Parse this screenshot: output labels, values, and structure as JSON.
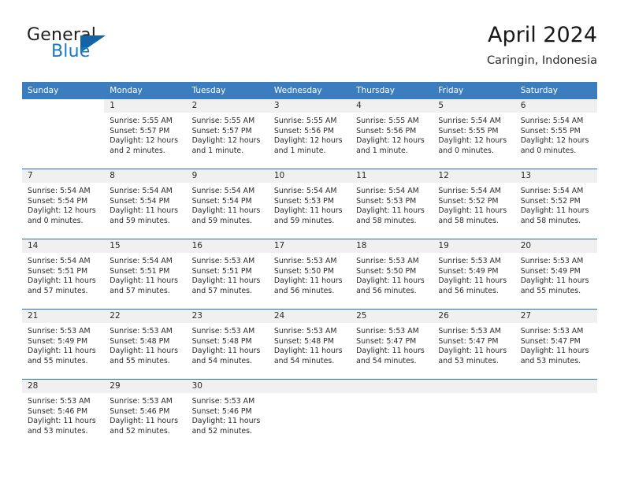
{
  "brand": {
    "word_general": "General",
    "word_blue": "Blue",
    "triangle_icon": "brand-triangle-icon",
    "accent_color": "#1b79c3"
  },
  "header": {
    "title": "April 2024",
    "subtitle": "Caringin, Indonesia"
  },
  "theme": {
    "header_blue": "#3b7dbf",
    "rule_blue": "#2a6cb0",
    "daynum_band": "#f0f0f0",
    "text": "#2b2b2b"
  },
  "calendar": {
    "weekday_headers": [
      "Sunday",
      "Monday",
      "Tuesday",
      "Wednesday",
      "Thursday",
      "Friday",
      "Saturday"
    ],
    "weeks": [
      [
        {
          "day": "",
          "blank": true,
          "lines": []
        },
        {
          "day": "1",
          "lines": [
            "Sunrise: 5:55 AM",
            "Sunset: 5:57 PM",
            "Daylight: 12 hours",
            "and 2 minutes."
          ]
        },
        {
          "day": "2",
          "lines": [
            "Sunrise: 5:55 AM",
            "Sunset: 5:57 PM",
            "Daylight: 12 hours",
            "and 1 minute."
          ]
        },
        {
          "day": "3",
          "lines": [
            "Sunrise: 5:55 AM",
            "Sunset: 5:56 PM",
            "Daylight: 12 hours",
            "and 1 minute."
          ]
        },
        {
          "day": "4",
          "lines": [
            "Sunrise: 5:55 AM",
            "Sunset: 5:56 PM",
            "Daylight: 12 hours",
            "and 1 minute."
          ]
        },
        {
          "day": "5",
          "lines": [
            "Sunrise: 5:54 AM",
            "Sunset: 5:55 PM",
            "Daylight: 12 hours",
            "and 0 minutes."
          ]
        },
        {
          "day": "6",
          "lines": [
            "Sunrise: 5:54 AM",
            "Sunset: 5:55 PM",
            "Daylight: 12 hours",
            "and 0 minutes."
          ]
        }
      ],
      [
        {
          "day": "7",
          "lines": [
            "Sunrise: 5:54 AM",
            "Sunset: 5:54 PM",
            "Daylight: 12 hours",
            "and 0 minutes."
          ]
        },
        {
          "day": "8",
          "lines": [
            "Sunrise: 5:54 AM",
            "Sunset: 5:54 PM",
            "Daylight: 11 hours",
            "and 59 minutes."
          ]
        },
        {
          "day": "9",
          "lines": [
            "Sunrise: 5:54 AM",
            "Sunset: 5:54 PM",
            "Daylight: 11 hours",
            "and 59 minutes."
          ]
        },
        {
          "day": "10",
          "lines": [
            "Sunrise: 5:54 AM",
            "Sunset: 5:53 PM",
            "Daylight: 11 hours",
            "and 59 minutes."
          ]
        },
        {
          "day": "11",
          "lines": [
            "Sunrise: 5:54 AM",
            "Sunset: 5:53 PM",
            "Daylight: 11 hours",
            "and 58 minutes."
          ]
        },
        {
          "day": "12",
          "lines": [
            "Sunrise: 5:54 AM",
            "Sunset: 5:52 PM",
            "Daylight: 11 hours",
            "and 58 minutes."
          ]
        },
        {
          "day": "13",
          "lines": [
            "Sunrise: 5:54 AM",
            "Sunset: 5:52 PM",
            "Daylight: 11 hours",
            "and 58 minutes."
          ]
        }
      ],
      [
        {
          "day": "14",
          "lines": [
            "Sunrise: 5:54 AM",
            "Sunset: 5:51 PM",
            "Daylight: 11 hours",
            "and 57 minutes."
          ]
        },
        {
          "day": "15",
          "lines": [
            "Sunrise: 5:54 AM",
            "Sunset: 5:51 PM",
            "Daylight: 11 hours",
            "and 57 minutes."
          ]
        },
        {
          "day": "16",
          "lines": [
            "Sunrise: 5:53 AM",
            "Sunset: 5:51 PM",
            "Daylight: 11 hours",
            "and 57 minutes."
          ]
        },
        {
          "day": "17",
          "lines": [
            "Sunrise: 5:53 AM",
            "Sunset: 5:50 PM",
            "Daylight: 11 hours",
            "and 56 minutes."
          ]
        },
        {
          "day": "18",
          "lines": [
            "Sunrise: 5:53 AM",
            "Sunset: 5:50 PM",
            "Daylight: 11 hours",
            "and 56 minutes."
          ]
        },
        {
          "day": "19",
          "lines": [
            "Sunrise: 5:53 AM",
            "Sunset: 5:49 PM",
            "Daylight: 11 hours",
            "and 56 minutes."
          ]
        },
        {
          "day": "20",
          "lines": [
            "Sunrise: 5:53 AM",
            "Sunset: 5:49 PM",
            "Daylight: 11 hours",
            "and 55 minutes."
          ]
        }
      ],
      [
        {
          "day": "21",
          "lines": [
            "Sunrise: 5:53 AM",
            "Sunset: 5:49 PM",
            "Daylight: 11 hours",
            "and 55 minutes."
          ]
        },
        {
          "day": "22",
          "lines": [
            "Sunrise: 5:53 AM",
            "Sunset: 5:48 PM",
            "Daylight: 11 hours",
            "and 55 minutes."
          ]
        },
        {
          "day": "23",
          "lines": [
            "Sunrise: 5:53 AM",
            "Sunset: 5:48 PM",
            "Daylight: 11 hours",
            "and 54 minutes."
          ]
        },
        {
          "day": "24",
          "lines": [
            "Sunrise: 5:53 AM",
            "Sunset: 5:48 PM",
            "Daylight: 11 hours",
            "and 54 minutes."
          ]
        },
        {
          "day": "25",
          "lines": [
            "Sunrise: 5:53 AM",
            "Sunset: 5:47 PM",
            "Daylight: 11 hours",
            "and 54 minutes."
          ]
        },
        {
          "day": "26",
          "lines": [
            "Sunrise: 5:53 AM",
            "Sunset: 5:47 PM",
            "Daylight: 11 hours",
            "and 53 minutes."
          ]
        },
        {
          "day": "27",
          "lines": [
            "Sunrise: 5:53 AM",
            "Sunset: 5:47 PM",
            "Daylight: 11 hours",
            "and 53 minutes."
          ]
        }
      ],
      [
        {
          "day": "28",
          "lines": [
            "Sunrise: 5:53 AM",
            "Sunset: 5:46 PM",
            "Daylight: 11 hours",
            "and 53 minutes."
          ]
        },
        {
          "day": "29",
          "lines": [
            "Sunrise: 5:53 AM",
            "Sunset: 5:46 PM",
            "Daylight: 11 hours",
            "and 52 minutes."
          ]
        },
        {
          "day": "30",
          "lines": [
            "Sunrise: 5:53 AM",
            "Sunset: 5:46 PM",
            "Daylight: 11 hours",
            "and 52 minutes."
          ]
        },
        {
          "day": "",
          "empty": true,
          "lines": []
        },
        {
          "day": "",
          "empty": true,
          "lines": []
        },
        {
          "day": "",
          "empty": true,
          "lines": []
        },
        {
          "day": "",
          "empty": true,
          "lines": []
        }
      ]
    ]
  }
}
